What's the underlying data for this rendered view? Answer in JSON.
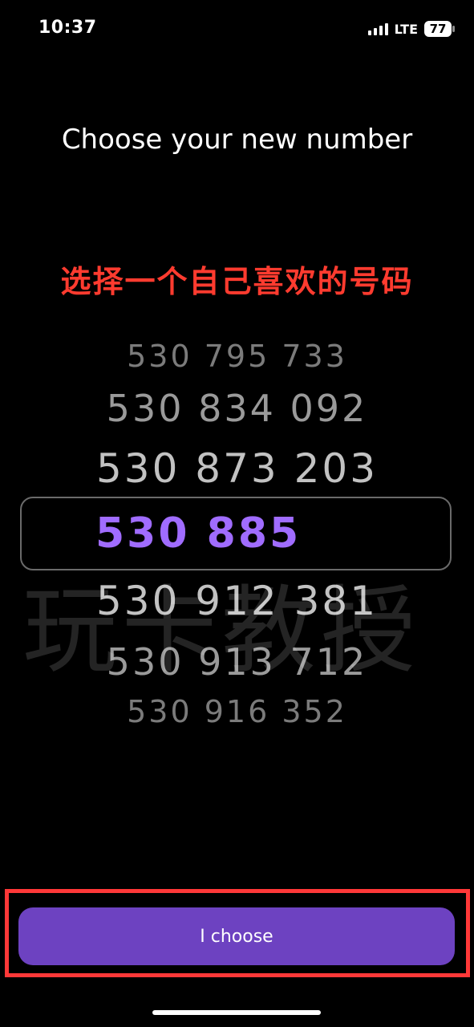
{
  "status_bar": {
    "time": "10:37",
    "network": "LTE",
    "battery": "77",
    "icons": [
      "signal-icon",
      "battery-icon"
    ]
  },
  "page": {
    "title": "Choose your new number",
    "annotation_cn": "选择一个自己喜欢的号码",
    "watermark": "玩卡教授"
  },
  "picker": {
    "items": [
      "530 795 733",
      "530 834 092",
      "530 873 203",
      "530 885",
      "530 912 381",
      "530 913 712",
      "530 916 352"
    ],
    "selected": "530 885"
  },
  "button": {
    "label": "I choose"
  },
  "colors": {
    "background": "#000000",
    "accent": "#6d42c1",
    "selected_text": "#a06cff",
    "annotation": "#ff3b2f",
    "highlight": "#ff3838"
  }
}
